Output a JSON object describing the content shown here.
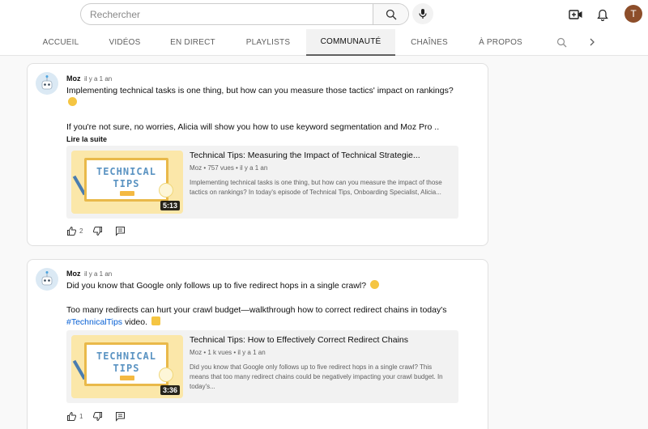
{
  "header": {
    "search_placeholder": "Rechercher",
    "avatar_letter": "T",
    "avatar_color": "#8d4e2a"
  },
  "tabs": [
    {
      "label": "ACCUEIL",
      "active": false
    },
    {
      "label": "VIDÉOS",
      "active": false
    },
    {
      "label": "EN DIRECT",
      "active": false
    },
    {
      "label": "PLAYLISTS",
      "active": false
    },
    {
      "label": "COMMUNAUTÉ",
      "active": true
    },
    {
      "label": "CHAÎNES",
      "active": false
    },
    {
      "label": "À PROPOS",
      "active": false
    }
  ],
  "posts": [
    {
      "author": "Moz",
      "time": "il y a 1 an",
      "text1": "Implementing technical tasks is one thing, but how can you measure those tactics' impact on rankings?",
      "text2": "If you're not sure, no worries, Alicia will show you how to use keyword segmentation and Moz Pro ..",
      "read_more": "Lire la suite",
      "video": {
        "title": "Technical Tips: Measuring the Impact of Technical Strategie...",
        "meta": "Moz • 757 vues • il y a 1 an",
        "desc": "Implementing technical tasks is one thing, but how can you measure the impact of those tactics on rankings? In today's episode of Technical Tips, Onboarding Specialist, Alicia...",
        "duration": "5:13",
        "thumb_line1": "TECHNICAL",
        "thumb_line2": "TIPS"
      },
      "likes": "2"
    },
    {
      "author": "Moz",
      "time": "il y a 1 an",
      "text1": "Did you know that Google only follows up to five redirect hops in a single crawl?",
      "text2": "Too many redirects can hurt your crawl budget—walkthrough how to correct redirect chains in today's",
      "hashtag": "#TechnicalTips",
      "text3": " video.",
      "video": {
        "title": "Technical Tips: How to Effectively Correct Redirect Chains",
        "meta": "Moz • 1 k vues • il y a 1 an",
        "desc": "Did you know that Google only follows up to five redirect hops in a single crawl? This means that too many redirect chains could be negatively impacting your crawl budget. In today's...",
        "duration": "3:36",
        "thumb_line1": "TECHNICAL",
        "thumb_line2": "TIPS"
      },
      "likes": "1"
    }
  ]
}
